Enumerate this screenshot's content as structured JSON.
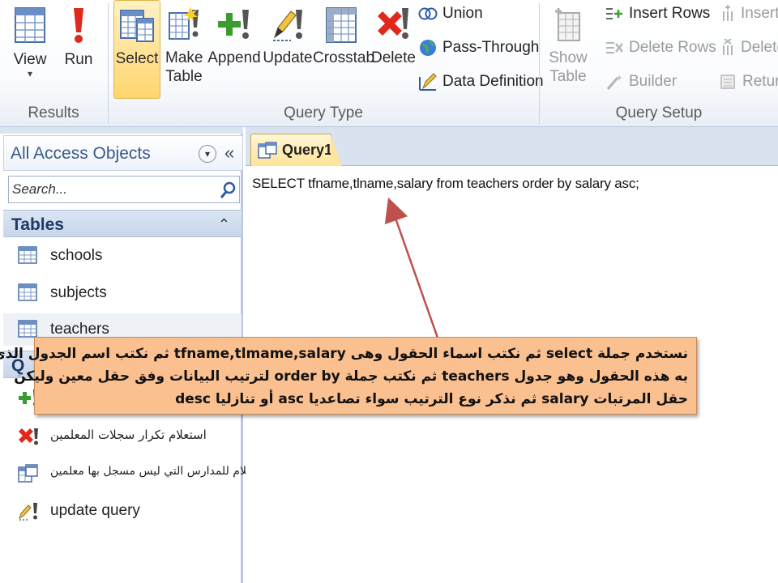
{
  "ribbon": {
    "results": {
      "label": "Results",
      "view_label": "View",
      "view_arrow": "▾",
      "run_label": "Run"
    },
    "query_type": {
      "label": "Query Type",
      "select_label": "Select",
      "make_table_label": "Make\nTable",
      "append_label": "Append",
      "update_label": "Update",
      "crosstab_label": "Crosstab",
      "delete_label": "Delete",
      "union_label": "Union",
      "pass_through_label": "Pass-Through",
      "data_definition_label": "Data Definition"
    },
    "query_setup": {
      "label": "Query Setup",
      "show_table_label": "Show\nTable",
      "insert_rows_label": "Insert Rows",
      "delete_rows_label": "Delete Rows",
      "builder_label": "Builder",
      "insert_cols_label": "Insert",
      "delete_cols_label": "Delete",
      "return_label": "Return"
    }
  },
  "nav": {
    "title": "All Access Objects",
    "menu_glyph": "▾",
    "collapse_glyph": "«",
    "search_placeholder": "Search...",
    "tables_header": "Tables",
    "tables_chevron": "⌃",
    "tables": [
      "schools",
      "subjects",
      "teachers"
    ],
    "queries_header": "Q",
    "queries": [
      {
        "label": "",
        "icon": "append-query-icon"
      },
      {
        "label": "استعلام تكرار سجلات  المعلمين",
        "icon": "delete-query-icon"
      },
      {
        "label": "استعلام للمدارس التي ليس مسجل بها معلمين",
        "icon": "crosstab-query-icon"
      },
      {
        "label": "update query",
        "icon": "update-query-icon"
      }
    ]
  },
  "document": {
    "tab_label": "Query1",
    "sql": "SELECT tfname,tlname,salary from teachers order by salary asc;"
  },
  "callout": {
    "line1": "نستخدم جملة  select ثم نكتب اسماء الحقول وهى tfname,tlmame,salary ثم نكتب اسم الجدول الذى",
    "line2": "به هذه الحقول وهو جدول teachers ثم نكتب جملة order by لترتيب البيانات وفق حقل معين وليكن",
    "line3": "حقل المرتبات salary ثم نذكر نوع الترتيب سواء تصاعديا asc أو تنازليا desc"
  },
  "colors": {
    "callout_bg": "#fac090",
    "arrow": "#c0504d",
    "select_active": "#ffd56f",
    "nav_section": "#c8d6ea"
  }
}
